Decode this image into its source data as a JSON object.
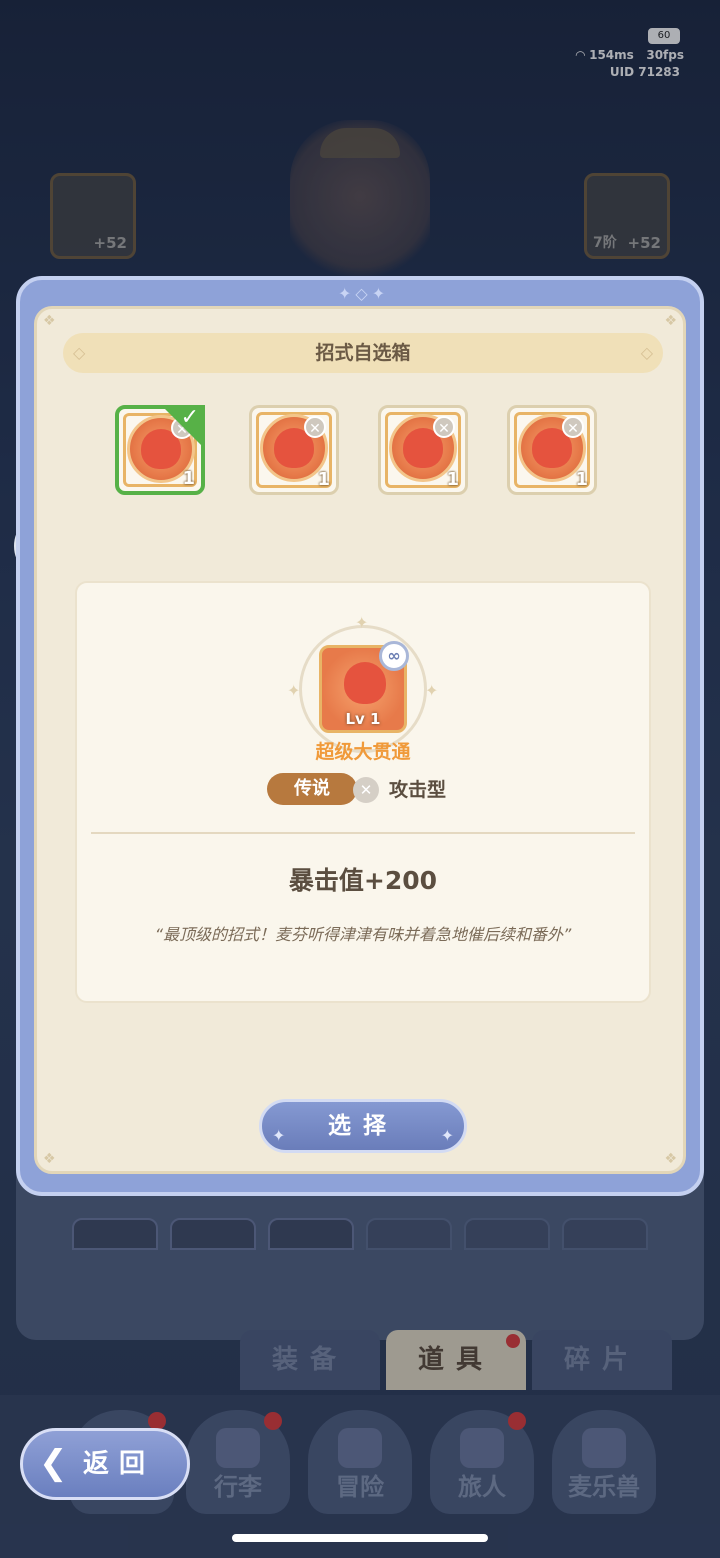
{
  "status": {
    "battery": "60",
    "ping": "154ms",
    "fps": "30fps",
    "uid": "UID 71283"
  },
  "background": {
    "left_equip_plus": "+52",
    "right_equip_tier": "7阶",
    "right_equip_plus": "+52",
    "tabs": [
      {
        "label": "装备"
      },
      {
        "label": "道具"
      },
      {
        "label": "碎片"
      }
    ],
    "nav": [
      {
        "label": "行李"
      },
      {
        "label": "冒险"
      },
      {
        "label": "旅人"
      },
      {
        "label": "麦乐兽"
      }
    ],
    "back_label": "返回"
  },
  "dialog": {
    "title": "招式自选箱",
    "options": [
      {
        "count": "1",
        "selected": true
      },
      {
        "count": "1",
        "selected": false
      },
      {
        "count": "1",
        "selected": false
      },
      {
        "count": "1",
        "selected": false
      }
    ],
    "detail": {
      "level": "Lv 1",
      "name": "超级大贯通",
      "rarity": "传说",
      "type": "攻击型",
      "stat": "暴击值+200",
      "quote": "“最顶级的招式！麦芬听得津津有味并着急地催后续和番外”"
    },
    "select_label": "选择"
  },
  "colors": {
    "accent": "#8ea2d8",
    "selected": "#57b147",
    "rarity": "#b7793e",
    "skill_name": "#f09a3a"
  }
}
